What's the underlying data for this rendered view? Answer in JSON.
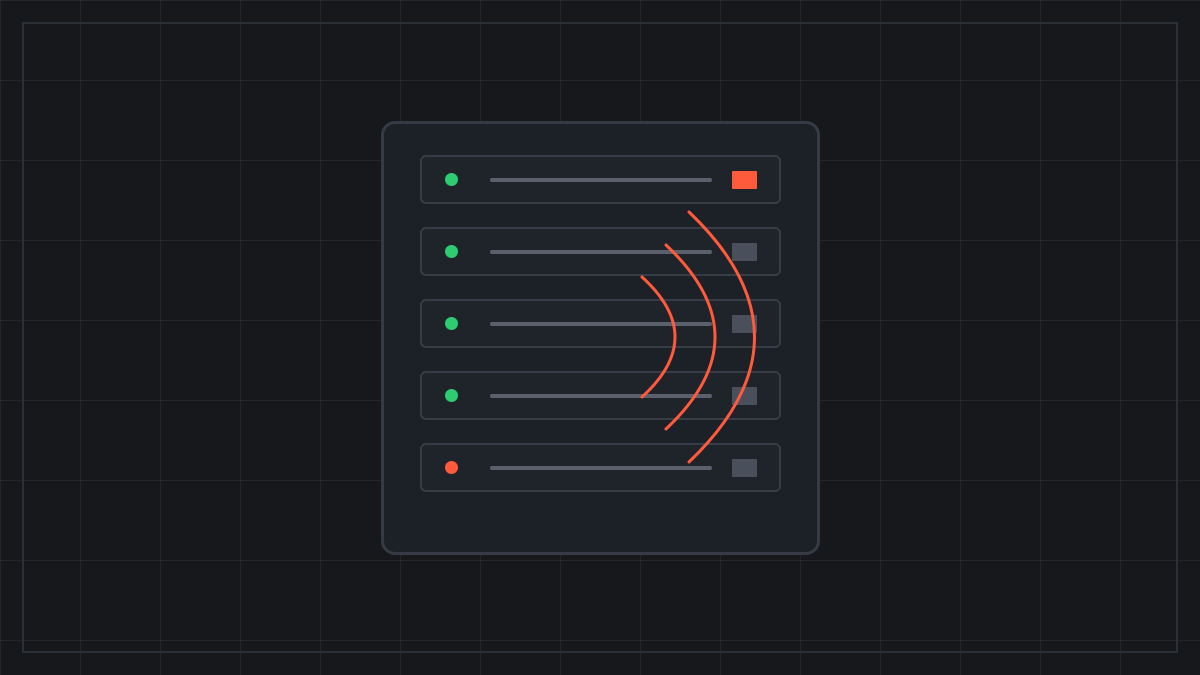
{
  "colors": {
    "background": "#16181c",
    "grid": "#262a30",
    "frame_border": "#2b3037",
    "rack_fill": "#1c2027",
    "rack_border": "#353b45",
    "slot_fill": "#1f232a",
    "slot_border": "#373d47",
    "bar": "#5a616c",
    "status_ok": "#2ecc71",
    "status_alert": "#ff5a3c",
    "port_idle": "#4a505b",
    "port_active": "#ff5a3c",
    "signal_wave": "#ff5a3c"
  },
  "rack": {
    "icon": "server-rack-icon",
    "slots": [
      {
        "status": "ok",
        "port": "active"
      },
      {
        "status": "ok",
        "port": "idle"
      },
      {
        "status": "ok",
        "port": "idle"
      },
      {
        "status": "ok",
        "port": "idle"
      },
      {
        "status": "alert",
        "port": "idle"
      }
    ]
  },
  "signal": {
    "icon": "wireless-signal-icon",
    "wave_count": 3
  }
}
